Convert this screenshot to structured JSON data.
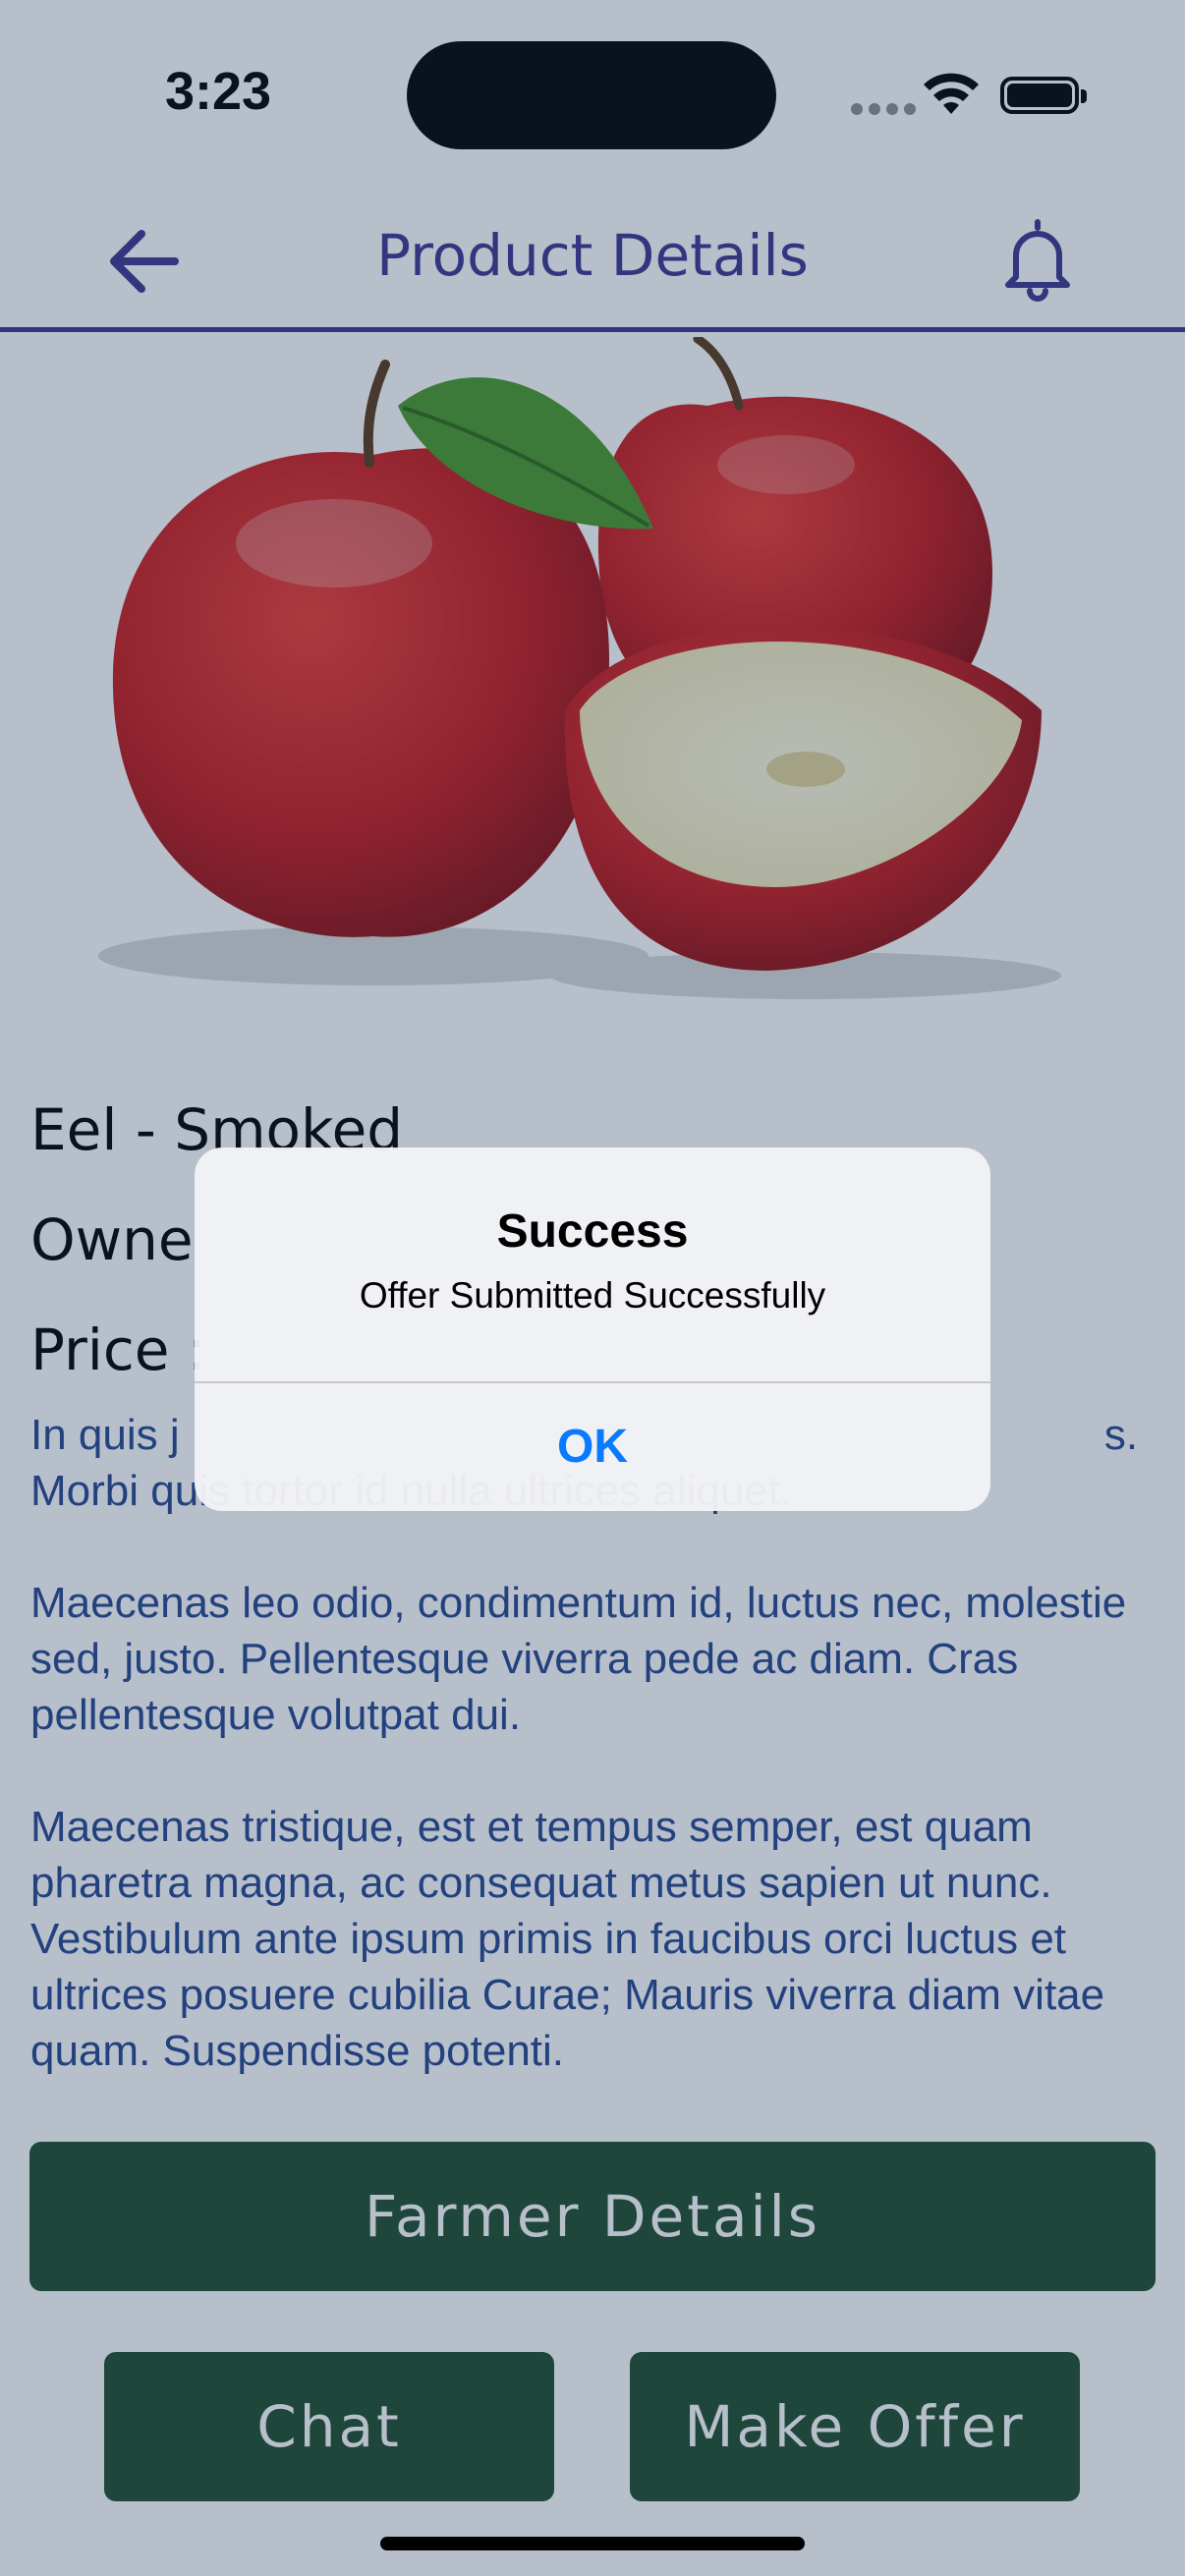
{
  "status_bar": {
    "time": "3:23"
  },
  "header": {
    "title": "Product Details",
    "back_icon": "arrow-left-icon",
    "notification_icon": "bell-icon"
  },
  "product": {
    "image": "apples-image",
    "title": "Eel - Smoked",
    "owner_label": "Owne",
    "price_label": "Price :",
    "description": "In quis j                                                                             s.\nMorbi quis tortor id nulla ultrices aliquet.\n\nMaecenas leo odio, condimentum id, luctus nec, molestie sed, justo. Pellentesque viverra pede ac diam. Cras pellentesque volutpat dui.\n\nMaecenas tristique, est et tempus semper, est quam pharetra magna, ac consequat metus sapien ut nunc. Vestibulum ante ipsum primis in faucibus orci luctus et ultrices posuere cubilia Curae; Mauris viverra diam vitae quam. Suspendisse potenti."
  },
  "buttons": {
    "farmer_details": "Farmer Details",
    "chat": "Chat",
    "make_offer": "Make Offer"
  },
  "alert": {
    "title": "Success",
    "message": "Offer Submitted Successfully",
    "ok": "OK"
  },
  "colors": {
    "accent": "#3b3691",
    "button": "#1e4d2b",
    "description": "#24468f",
    "alert_action": "#0a7aff"
  }
}
